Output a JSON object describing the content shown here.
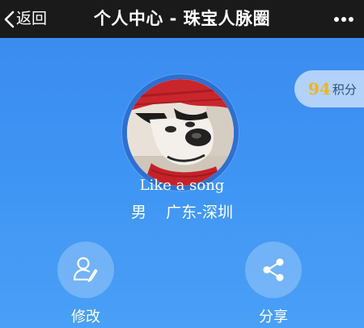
{
  "topbar": {
    "back_label": "返回",
    "title": "个人中心 - 珠宝人脉圈",
    "more_icon": "more-dots-icon"
  },
  "profile": {
    "avatar_icon": "profile-photo",
    "points": {
      "value": "94",
      "label": "积分",
      "value_color": "#f2b416"
    },
    "username": "Like a song",
    "gender": "男",
    "location": "广东-深圳"
  },
  "actions": [
    {
      "label": "修改",
      "icon": "edit-user-icon"
    },
    {
      "label": "分享",
      "icon": "share-icon"
    }
  ],
  "colors": {
    "topbar": "#1a1a1a",
    "background": "#3d8ff0",
    "accent_points": "#f2b416"
  }
}
